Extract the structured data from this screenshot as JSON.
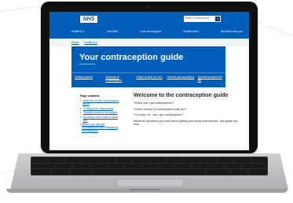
{
  "site": {
    "logo": "NHS",
    "search_placeholder": "Enter a search term",
    "nav": [
      "Health A-Z",
      "Live Well",
      "Care and support",
      "Health news",
      "Services near you"
    ]
  },
  "breadcrumb": [
    "Home",
    "Health A-Z"
  ],
  "hero": {
    "title": "Your contraception guide",
    "tabs": [
      "Getting started",
      "Methods of contraception",
      "Which is best for me?",
      "Worries and questions",
      "Questions about the pill"
    ]
  },
  "toc": {
    "heading": "Page contents",
    "items": [
      "Welcome to the contraception guide",
      "Finding your way around",
      "Regular subjects and pages",
      "Deciding which method suits you",
      "Where you can get contraception and emergency contraception"
    ]
  },
  "main": {
    "heading": "Welcome to the contraception guide",
    "paragraphs": [
      "\"Where can I get contraception?\"",
      "\"Which method of contraception suits me?\"",
      "\"I'm under 16 - can I get contraception?\"",
      "Whatever questions you have about getting and using contraception, this guide can help."
    ]
  },
  "colors": {
    "brand": "#005eb8",
    "link": "#005eb8",
    "text": "#212b32"
  }
}
